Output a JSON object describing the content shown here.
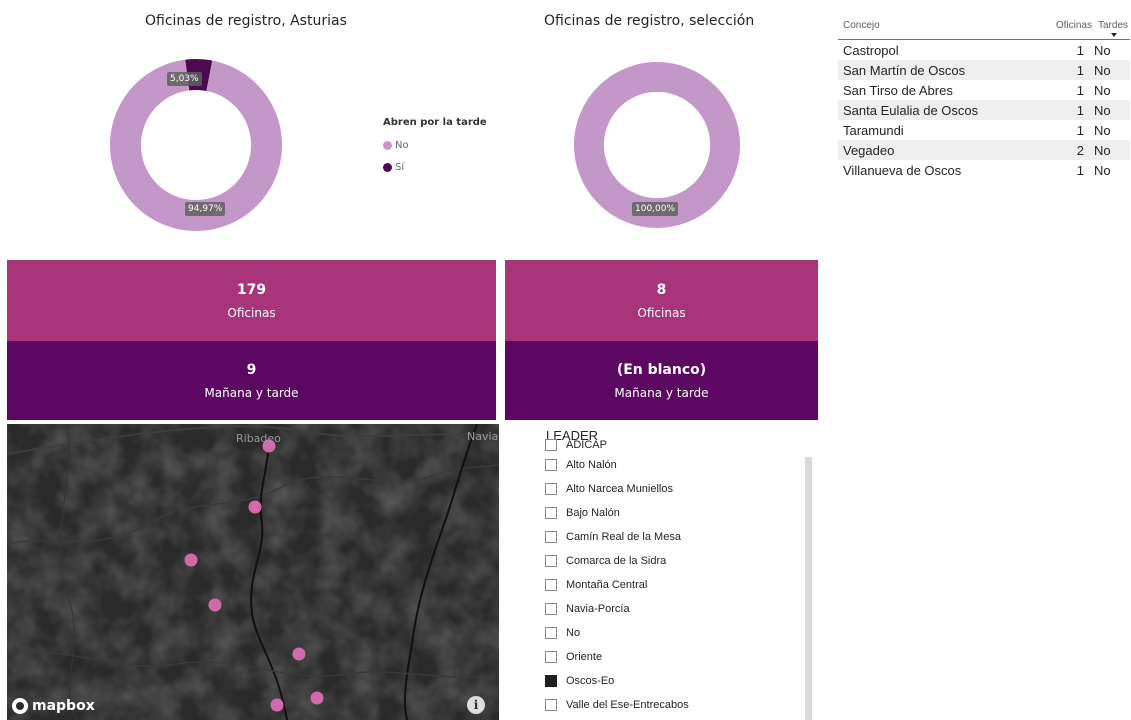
{
  "donut_left": {
    "title": "Oficinas de registro, Asturias",
    "label_no": "94,97%",
    "label_si": "5,03%",
    "fraction_no": 0.9497,
    "fraction_si": 0.0503
  },
  "donut_right": {
    "title": "Oficinas de registro, selección",
    "label_no": "100,00%",
    "fraction_no": 1.0
  },
  "legend": {
    "title": "Abren por la tarde",
    "items": [
      {
        "label": "No",
        "color": "#c497c9"
      },
      {
        "label": "Sí",
        "color": "#4b0b4e"
      }
    ]
  },
  "colors": {
    "no": "#c497c9",
    "si": "#4b0b4e",
    "card_top": "#a8357a",
    "card_bottom": "#5c0762",
    "table_header_line": "#2d7fd3",
    "map_point": "#d06aaa"
  },
  "cards": {
    "left_top": {
      "value": "179",
      "label": "Oficinas"
    },
    "left_bottom": {
      "value": "9",
      "label": "Mañana y tarde"
    },
    "right_top": {
      "value": "8",
      "label": "Oficinas"
    },
    "right_bottom": {
      "value": "(En blanco)",
      "label": "Mañana y tarde"
    }
  },
  "table": {
    "headers": [
      "Concejo",
      "Oficinas",
      "Tardes"
    ],
    "sorted_column": "Tardes",
    "rows": [
      [
        "Castropol",
        "1",
        "No"
      ],
      [
        "San Martín de Oscos",
        "1",
        "No"
      ],
      [
        "San Tirso de Abres",
        "1",
        "No"
      ],
      [
        "Santa Eulalia de Oscos",
        "1",
        "No"
      ],
      [
        "Taramundi",
        "1",
        "No"
      ],
      [
        "Vegadeo",
        "2",
        "No"
      ],
      [
        "Villanueva de Oscos",
        "1",
        "No"
      ]
    ]
  },
  "map": {
    "towns": [
      "Ribadeo",
      "Navia"
    ],
    "logo": "mapbox",
    "info_icon": "info-icon"
  },
  "slicer": {
    "title": "LEADER",
    "items": [
      {
        "label": "ADICAP",
        "checked": false
      },
      {
        "label": "Alto Nalón",
        "checked": false
      },
      {
        "label": "Alto Narcea Muniellos",
        "checked": false
      },
      {
        "label": "Bajo Nalón",
        "checked": false
      },
      {
        "label": "Camín Real de la Mesa",
        "checked": false
      },
      {
        "label": "Comarca de la Sidra",
        "checked": false
      },
      {
        "label": "Montaña Central",
        "checked": false
      },
      {
        "label": "Navia-Porcía",
        "checked": false
      },
      {
        "label": "No",
        "checked": false
      },
      {
        "label": "Oriente",
        "checked": false
      },
      {
        "label": "Oscos-Eo",
        "checked": true
      },
      {
        "label": "Valle del Ese-Entrecabos",
        "checked": false
      }
    ]
  }
}
